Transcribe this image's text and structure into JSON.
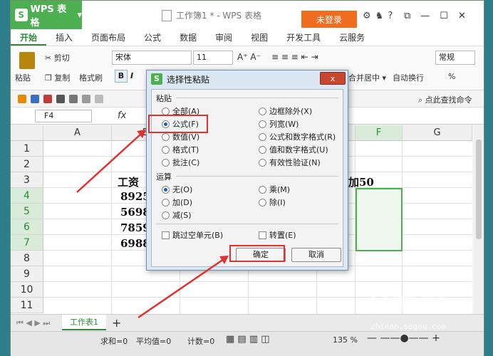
{
  "app": {
    "brand": "WPS 表格",
    "brand_logo": "S",
    "doc_title": "工作簿1 * - WPS 表格",
    "login": "未登录"
  },
  "tabs": [
    "开始",
    "插入",
    "页面布局",
    "公式",
    "数据",
    "审阅",
    "视图",
    "开发工具",
    "云服务"
  ],
  "ribbon": {
    "paste": "粘贴",
    "cut": "剪切",
    "copy": "复制",
    "format_painter": "格式刷",
    "font": "宋体",
    "size": "11",
    "merge": "合并居中",
    "wrap": "自动换行",
    "number_format": "常规",
    "percent": "%",
    "bold": "B",
    "italic": "I"
  },
  "quickbar": {
    "find_cmd": "点此查找命令"
  },
  "formula_bar": {
    "cell_ref": "F4",
    "fx": "fx"
  },
  "grid": {
    "columns": [
      "A",
      "B",
      "C",
      "D",
      "E",
      "F",
      "G"
    ],
    "rows": [
      "1",
      "2",
      "3",
      "4",
      "5",
      "6",
      "7",
      "8",
      "9",
      "10",
      "11"
    ],
    "cells": {
      "b3": "工资",
      "b4": "8925",
      "b5": "5698",
      "b6": "7859",
      "b7": "6988",
      "e3": "加50"
    }
  },
  "sheets": [
    "工作表1"
  ],
  "status": {
    "sum": "求和=0",
    "avg": "平均值=0",
    "count": "计数=0",
    "zoom": "135 %"
  },
  "dialog": {
    "title": "选择性粘贴",
    "close": "x",
    "paste_group": "粘贴",
    "paste_options_left": [
      "全部(A)",
      "公式(F)",
      "数值(V)",
      "格式(T)",
      "批注(C)"
    ],
    "paste_options_right": [
      "边框除外(X)",
      "列宽(W)",
      "公式和数字格式(R)",
      "值和数字格式(U)",
      "有效性验证(N)"
    ],
    "paste_selected": "公式(F)",
    "op_group": "运算",
    "op_options_left": [
      "无(O)",
      "加(D)",
      "减(S)"
    ],
    "op_options_right": [
      "乘(M)",
      "除(I)"
    ],
    "op_selected": "无(O)",
    "skip_blanks": "跳过空单元(B)",
    "transpose": "转置(E)",
    "ok": "确定",
    "cancel": "取消"
  },
  "watermark": {
    "name": "搜狗指南",
    "url": "zhinan.sogou.com"
  },
  "colors": {
    "accent": "#4caf50",
    "login": "#f06c1f",
    "highlight": "#e0322e",
    "dialog_bg": "#dbe7f3"
  }
}
